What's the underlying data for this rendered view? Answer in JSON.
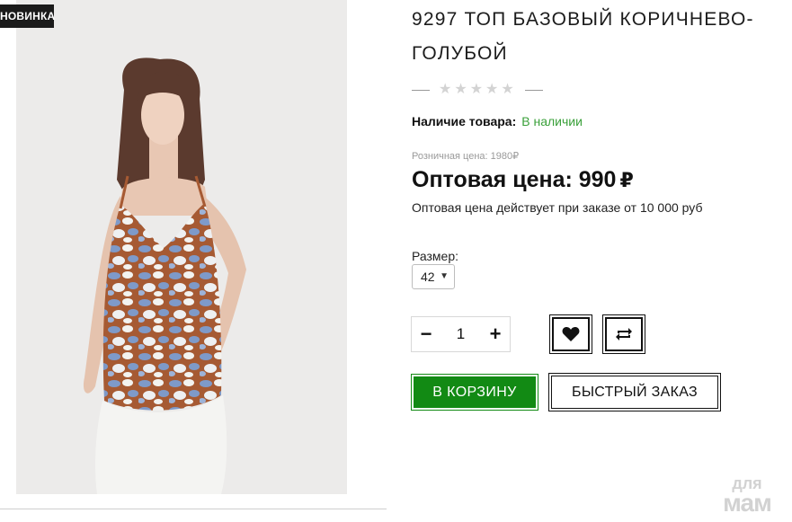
{
  "badge": "НОВИНКА",
  "product": {
    "title": "9297 ТОП БАЗОВЫЙ КОРИЧНЕВО-ГОЛУБОЙ",
    "rating": 0,
    "rating_max": 5,
    "availability_label": "Наличие товара:",
    "availability_value": "В наличии",
    "retail_price_text": "Розничная цена: 1980₽",
    "wholesale_price_text": "Оптовая цена: 990",
    "currency": "₽",
    "wholesale_note": "Оптовая цена действует при заказе от 10 000 руб",
    "size_label": "Размер:",
    "size_selected": "42",
    "quantity": "1"
  },
  "actions": {
    "qty_minus": "−",
    "qty_plus": "+",
    "wishlist_icon": "heart-icon",
    "compare_icon": "repeat-icon",
    "add_to_cart": "В КОРЗИНУ",
    "quick_order": "БЫСТРЫЙ ЗАКАЗ"
  },
  "watermark": {
    "line1": "для",
    "line2": "мам"
  },
  "colors": {
    "accent_green": "#128a14",
    "in_stock_green": "#3aa03a",
    "badge_bg": "#1b1b1b"
  }
}
